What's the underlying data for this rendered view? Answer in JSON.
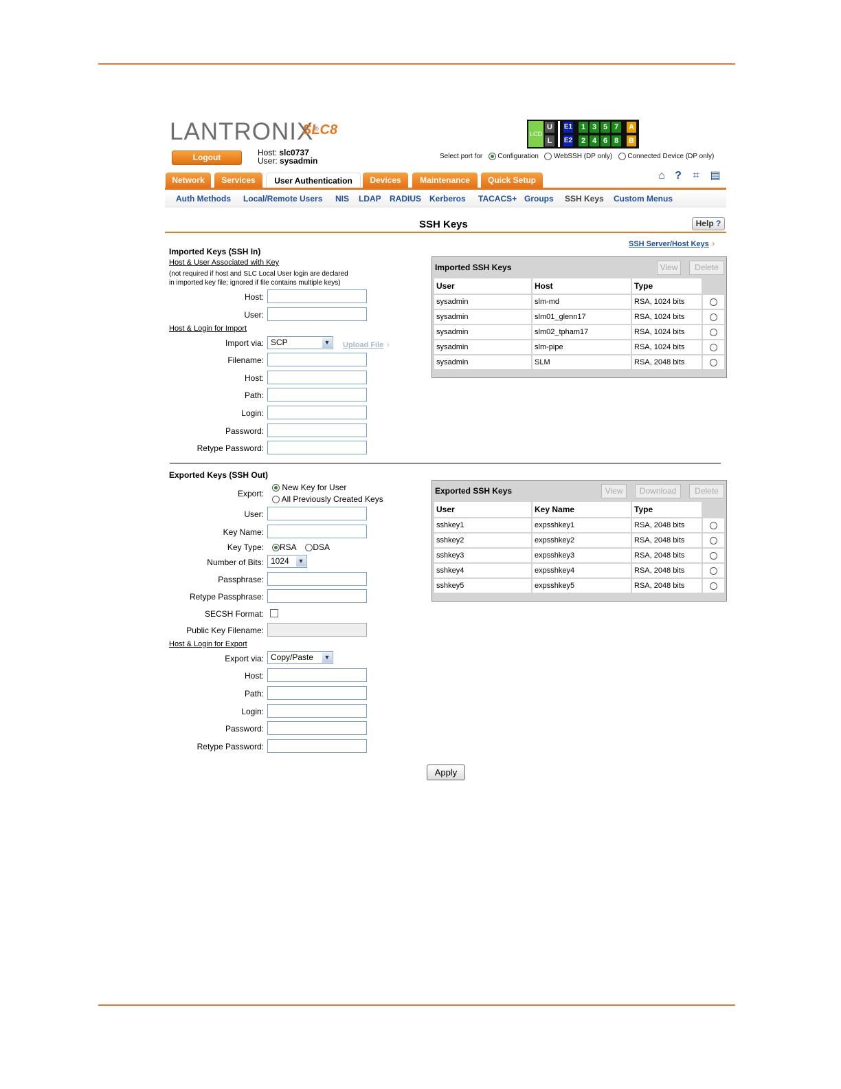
{
  "brand": {
    "logo": "LANTRONIX",
    "reg": "®",
    "model": "SLC8"
  },
  "logout_label": "Logout",
  "host_label": "Host:",
  "host_value": "slc0737",
  "user_label": "User:",
  "user_value": "sysadmin",
  "ports": {
    "lcd": "LCD",
    "u": "U",
    "l": "L",
    "e1": "E1",
    "e2": "E2",
    "top": [
      "1",
      "3",
      "5",
      "7"
    ],
    "bottom": [
      "2",
      "4",
      "6",
      "8"
    ],
    "a": "A",
    "b": "B"
  },
  "port_select": {
    "label": "Select port for",
    "options": [
      "Configuration",
      "WebSSH (DP only)",
      "Connected Device (DP only)"
    ],
    "selected": "Configuration"
  },
  "tabs": [
    "Network",
    "Services",
    "User Authentication",
    "Devices",
    "Maintenance",
    "Quick Setup"
  ],
  "active_tab": "User Authentication",
  "subnav": [
    "Auth Methods",
    "Local/Remote Users",
    "NIS",
    "LDAP",
    "RADIUS",
    "Kerberos",
    "TACACS+",
    "Groups",
    "SSH Keys",
    "Custom Menus"
  ],
  "current_subnav": "SSH Keys",
  "icons": [
    "home-icon",
    "help-icon",
    "network-icon",
    "log-icon"
  ],
  "page_title": "SSH Keys",
  "help_label": "Help",
  "server_host_keys_link": "SSH Server/Host Keys",
  "imported": {
    "heading": "Imported Keys (SSH In)",
    "assoc_heading": "Host & User Associated with Key",
    "note_line1": "(not required if host and SLC Local User login are declared",
    "note_line2": "in imported key file; ignored if file contains multiple keys)",
    "host_label": "Host:",
    "user_label": "User:",
    "import_heading": "Host & Login for Import",
    "import_via_label": "Import via:",
    "import_via_value": "SCP",
    "upload_file": "Upload File",
    "filename_label": "Filename:",
    "host2_label": "Host:",
    "path_label": "Path:",
    "login_label": "Login:",
    "password_label": "Password:",
    "retype_password_label": "Retype Password:"
  },
  "imported_table": {
    "title": "Imported SSH Keys",
    "view": "View",
    "delete": "Delete",
    "headers": [
      "User",
      "Host",
      "Type"
    ],
    "rows": [
      [
        "sysadmin",
        "slm-md",
        "RSA, 1024 bits"
      ],
      [
        "sysadmin",
        "slm01_glenn17",
        "RSA, 1024 bits"
      ],
      [
        "sysadmin",
        "slm02_tpham17",
        "RSA, 1024 bits"
      ],
      [
        "sysadmin",
        "slm-pipe",
        "RSA, 1024 bits"
      ],
      [
        "sysadmin",
        "SLM",
        "RSA, 2048 bits"
      ]
    ]
  },
  "exported": {
    "heading": "Exported Keys (SSH Out)",
    "export_label": "Export:",
    "export_options": [
      "New Key for User",
      "All Previously Created Keys"
    ],
    "user_label": "User:",
    "key_name_label": "Key Name:",
    "key_type_label": "Key Type:",
    "key_types": [
      "RSA",
      "DSA"
    ],
    "bits_label": "Number of Bits:",
    "bits_value": "1024",
    "passphrase_label": "Passphrase:",
    "retype_passphrase_label": "Retype Passphrase:",
    "secsh_label": "SECSH Format:",
    "pubkey_label": "Public Key Filename:",
    "export_heading": "Host & Login for Export",
    "export_via_label": "Export via:",
    "export_via_value": "Copy/Paste",
    "host_label": "Host:",
    "path_label": "Path:",
    "login_label": "Login:",
    "password_label": "Password:",
    "retype_password_label": "Retype Password:"
  },
  "exported_table": {
    "title": "Exported SSH Keys",
    "view": "View",
    "download": "Download",
    "delete": "Delete",
    "headers": [
      "User",
      "Key Name",
      "Type"
    ],
    "rows": [
      [
        "sshkey1",
        "expsshkey1",
        "RSA, 2048 bits"
      ],
      [
        "sshkey2",
        "expsshkey2",
        "RSA, 2048 bits"
      ],
      [
        "sshkey3",
        "expsshkey3",
        "RSA, 2048 bits"
      ],
      [
        "sshkey4",
        "expsshkey4",
        "RSA, 2048 bits"
      ],
      [
        "sshkey5",
        "expsshkey5",
        "RSA, 2048 bits"
      ]
    ]
  },
  "apply_label": "Apply",
  "colors": {
    "accent": "#e87722",
    "link": "#1f4fa0",
    "port_green": "#1a8a1a",
    "port_blue": "#0a1fc0",
    "port_amber": "#e8a000"
  }
}
